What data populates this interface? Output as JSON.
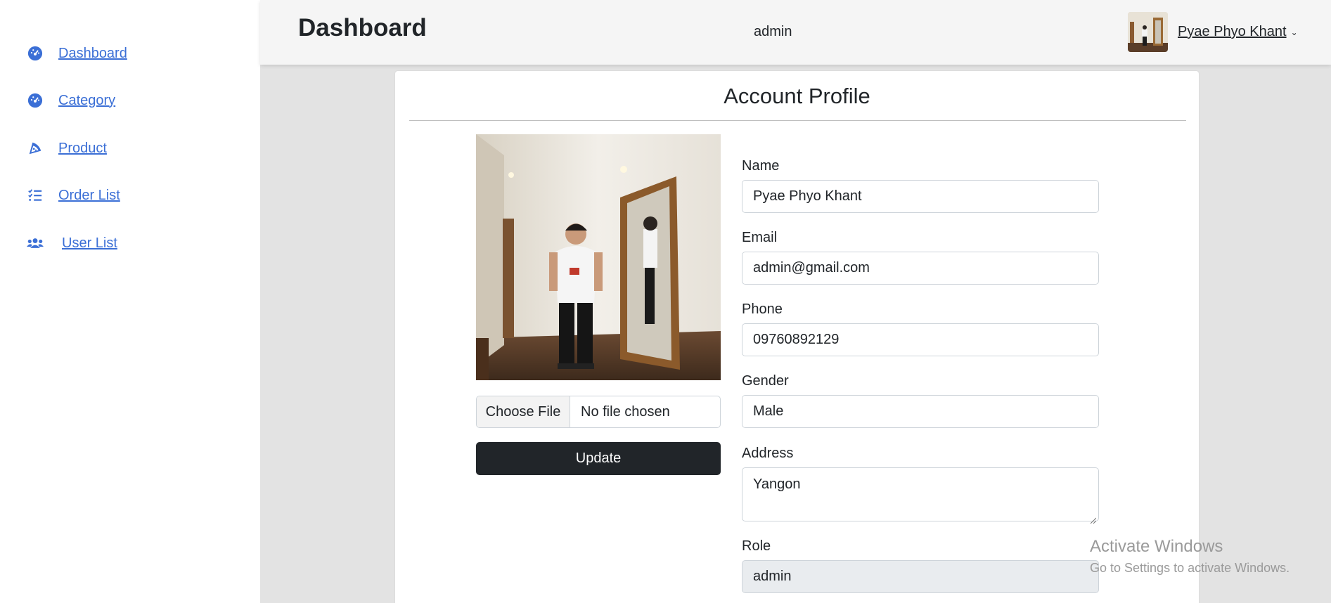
{
  "sidebar": {
    "items": [
      {
        "label": "Dashboard",
        "icon": "gauge-icon"
      },
      {
        "label": "Category",
        "icon": "gauge-icon"
      },
      {
        "label": "Product",
        "icon": "pizza-slice-icon"
      },
      {
        "label": "Order List",
        "icon": "list-check-icon"
      },
      {
        "label": "User List",
        "icon": "users-icon"
      }
    ]
  },
  "header": {
    "title": "Dashboard",
    "role": "admin",
    "user_name": "Pyae Phyo Khant"
  },
  "profile": {
    "title": "Account Profile",
    "file_button": "Choose File",
    "file_status": "No file chosen",
    "update_label": "Update",
    "fields": {
      "name": {
        "label": "Name",
        "value": "Pyae Phyo Khant"
      },
      "email": {
        "label": "Email",
        "value": "admin@gmail.com"
      },
      "phone": {
        "label": "Phone",
        "value": "09760892129"
      },
      "gender": {
        "label": "Gender",
        "value": "Male"
      },
      "address": {
        "label": "Address",
        "value": "Yangon"
      },
      "role": {
        "label": "Role",
        "value": "admin"
      }
    }
  },
  "watermark": {
    "line1": "Activate Windows",
    "line2": "Go to Settings to activate Windows."
  },
  "colors": {
    "link": "#3b6fd6",
    "button_dark": "#212529",
    "background": "#e3e3e3"
  }
}
